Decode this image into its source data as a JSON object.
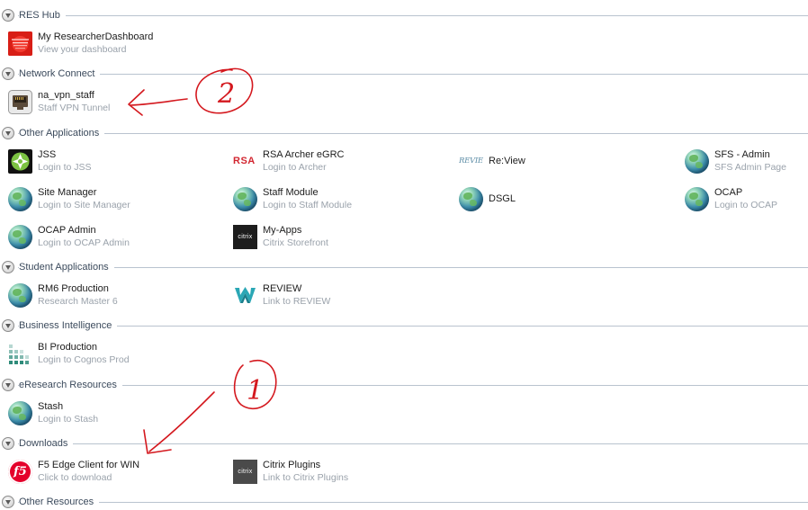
{
  "sections": {
    "res_hub": {
      "title": "RES Hub"
    },
    "network_connect": {
      "title": "Network Connect"
    },
    "other_applications": {
      "title": "Other Applications"
    },
    "student_applications": {
      "title": "Student Applications"
    },
    "business_intelligence": {
      "title": "Business Intelligence"
    },
    "eresearch_resources": {
      "title": "eResearch Resources"
    },
    "downloads": {
      "title": "Downloads"
    },
    "other_resources": {
      "title": "Other Resources"
    }
  },
  "apps": {
    "researcher_dashboard": {
      "name": "My ResearcherDashboard",
      "desc": "View your dashboard",
      "icon": "dashboard-icon"
    },
    "na_vpn_staff": {
      "name": "na_vpn_staff",
      "desc": "Staff VPN Tunnel",
      "icon": "network-jack-icon"
    },
    "jss": {
      "name": "JSS",
      "desc": "Login to JSS",
      "icon": "jss-icon"
    },
    "rsa_archer": {
      "name": "RSA Archer eGRC",
      "desc": "Login to Archer",
      "icon": "rsa-logo-icon",
      "logo_text": "RSA",
      "logo_color": "#d22630"
    },
    "review_app": {
      "name": "Re:View",
      "icon": "review-logo-icon",
      "logo_text": "REVIEW"
    },
    "sfs_admin": {
      "name": "SFS - Admin",
      "desc": "SFS Admin Page",
      "icon": "globe-icon"
    },
    "site_manager": {
      "name": "Site Manager",
      "desc": "Login to Site Manager",
      "icon": "globe-icon"
    },
    "staff_module": {
      "name": "Staff Module",
      "desc": "Login to Staff Module",
      "icon": "globe-icon"
    },
    "dsgl": {
      "name": "DSGL",
      "icon": "globe-icon"
    },
    "ocap": {
      "name": "OCAP",
      "desc": "Login to OCAP",
      "icon": "globe-icon"
    },
    "ocap_admin": {
      "name": "OCAP Admin",
      "desc": "Login to OCAP Admin",
      "icon": "globe-icon"
    },
    "my_apps": {
      "name": "My-Apps",
      "desc": "Citrix Storefront",
      "icon": "citrix-icon",
      "logo_text": "citrix"
    },
    "rm6": {
      "name": "RM6 Production",
      "desc": "Research Master 6",
      "icon": "globe-icon"
    },
    "review_student": {
      "name": "REVIEW",
      "desc": "Link to REVIEW",
      "icon": "review-w-icon"
    },
    "bi_production": {
      "name": "BI Production",
      "desc": "Login to Cognos Prod",
      "icon": "cognos-icon"
    },
    "stash": {
      "name": "Stash",
      "desc": "Login to Stash",
      "icon": "globe-icon"
    },
    "f5_edge": {
      "name": "F5 Edge Client for WIN",
      "desc": "Click to download",
      "icon": "f5-logo-icon",
      "logo_text": "f5",
      "logo_color": "#e4002b"
    },
    "citrix_plugins": {
      "name": "Citrix Plugins",
      "desc": "Link to Citrix Plugins",
      "icon": "citrix-icon",
      "logo_text": "citrix"
    }
  },
  "annotations": {
    "color": "#d4181e",
    "circle_2_label": "2",
    "circle_1_label": "1"
  }
}
